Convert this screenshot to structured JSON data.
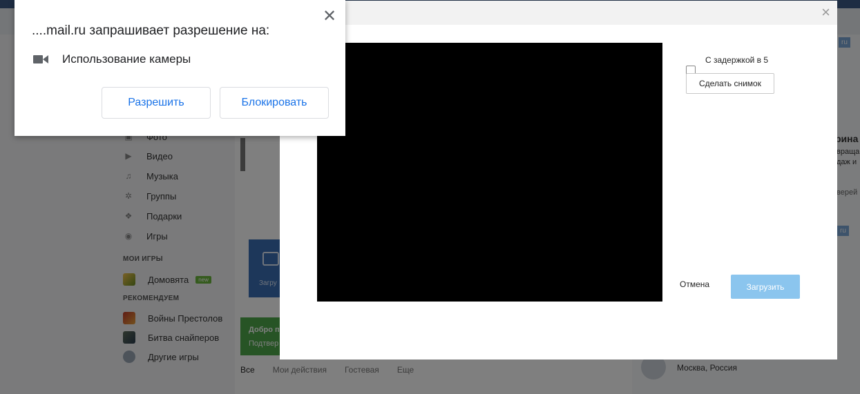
{
  "background": {
    "sidebar": {
      "items": [
        {
          "label": "Фото",
          "icon": "photo-icon"
        },
        {
          "label": "Видео",
          "icon": "video-icon"
        },
        {
          "label": "Музыка",
          "icon": "music-icon"
        },
        {
          "label": "Группы",
          "icon": "groups-icon"
        },
        {
          "label": "Подарки",
          "icon": "gift-icon"
        },
        {
          "label": "Игры",
          "icon": "games-icon"
        }
      ],
      "my_games_heading": "МОИ ИГРЫ",
      "my_games": [
        {
          "label": "Домовята",
          "badge": "new"
        }
      ],
      "recommend_heading": "РЕКОМЕНДУЕМ",
      "recommended": [
        {
          "label": "Войны Престолов"
        },
        {
          "label": "Битва снайперов"
        },
        {
          "label": "Другие игры"
        }
      ]
    },
    "center": {
      "upload_card_label": "Загру",
      "welcome_title": "Добро п",
      "welcome_sub": "Подтвер",
      "feed_tabs": [
        "Все",
        "Мои действия",
        "Гостевая",
        "Еще"
      ]
    },
    "right": {
      "ru_tag_1": "ru",
      "ru_tag_2": "ru",
      "line1": "рина",
      "line2": "враща",
      "line3": "даж и",
      "line4": "верей",
      "location": "Москва, Россия"
    }
  },
  "camera_modal": {
    "close_symbol": "×",
    "delay_label": "С задержкой в 5",
    "delay_checked": false,
    "snapshot_button": "Сделать снимок",
    "cancel_link": "Отмена",
    "upload_button": "Загрузить"
  },
  "permission_prompt": {
    "title": "....mail.ru запрашивает разрешение на:",
    "permission_item": "Использование камеры",
    "allow_button": "Разрешить",
    "block_button": "Блокировать",
    "close_symbol": "✕"
  },
  "colors": {
    "accent_blue": "#1a73e8",
    "upload_disabled": "#8bc5ee",
    "video_bg": "#000000"
  }
}
